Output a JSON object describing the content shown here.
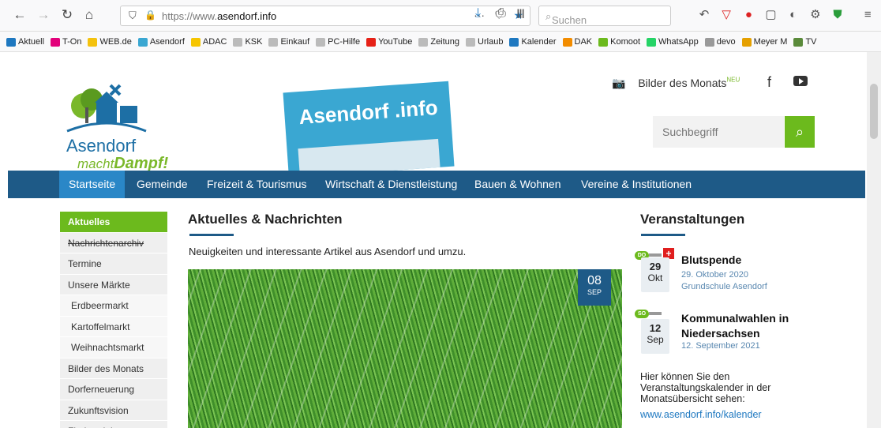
{
  "browser": {
    "url_prefix": "https://www.",
    "url_domain": "asendorf.info",
    "search_placeholder": "Suchen",
    "bookmarks": [
      {
        "label": "Aktuell",
        "color": "#1e78c0"
      },
      {
        "label": "T-On",
        "color": "#e2007a"
      },
      {
        "label": "WEB.de",
        "color": "#f4c20d"
      },
      {
        "label": "Asendorf",
        "color": "#3aa7d2"
      },
      {
        "label": "ADAC",
        "color": "#f6c500"
      },
      {
        "label": "KSK",
        "color": "#bbbbbb"
      },
      {
        "label": "Einkauf",
        "color": "#bbbbbb"
      },
      {
        "label": "PC-Hilfe",
        "color": "#bbbbbb"
      },
      {
        "label": "YouTube",
        "color": "#e62117"
      },
      {
        "label": "Zeitung",
        "color": "#bbbbbb"
      },
      {
        "label": "Urlaub",
        "color": "#bbbbbb"
      },
      {
        "label": "Kalender",
        "color": "#1e78c0"
      },
      {
        "label": "DAK",
        "color": "#f28c00"
      },
      {
        "label": "Komoot",
        "color": "#6cba1d"
      },
      {
        "label": "WhatsApp",
        "color": "#25d366"
      },
      {
        "label": "devo",
        "color": "#999999"
      },
      {
        "label": "Meyer M",
        "color": "#e5a000"
      },
      {
        "label": "TV",
        "color": "#5a8a3a"
      }
    ]
  },
  "header": {
    "logo_line1": "Asendorf",
    "logo_line2_a": "macht",
    "logo_line2_b": "Dampf!",
    "magazine_title": "Asendorf .info",
    "photos_link": "Bilder des Monats",
    "photos_badge": "NEU",
    "site_search_placeholder": "Suchbegriff"
  },
  "nav": {
    "items": [
      "Startseite",
      "Gemeinde",
      "Freizeit & Tourismus",
      "Wirtschaft & Dienstleistung",
      "Bauen & Wohnen",
      "Vereine & Institutionen"
    ]
  },
  "sidebar": {
    "items": [
      "Aktuelles",
      "Nachrichtenarchiv",
      "Termine",
      "Unsere Märkte",
      "Erdbeermarkt",
      "Kartoffelmarkt",
      "Weihnachtsmarkt",
      "Bilder des Monats",
      "Dorferneuerung",
      "Zukunftsvision",
      "Flurbereinigung"
    ]
  },
  "main": {
    "title": "Aktuelles & Nachrichten",
    "intro": "Neuigkeiten und interessante Artikel aus Asendorf und umzu.",
    "date_day": "08",
    "date_month": "SEP"
  },
  "events": {
    "title": "Veranstaltungen",
    "list": [
      {
        "pill": "DO",
        "day": "29",
        "mon": "Okt",
        "name": "Blutspende",
        "date": "29. Oktober 2020",
        "place": "Grundschule Asendorf"
      },
      {
        "pill": "SO",
        "day": "12",
        "mon": "Sep",
        "name": "Kommunalwahlen in Niedersachsen",
        "date": "12. September 2021",
        "place": ""
      }
    ],
    "note": "Hier können Sie den Veranstaltungskalender in der Monatsübersicht sehen:",
    "link": "www.asendorf.info/kalender"
  }
}
